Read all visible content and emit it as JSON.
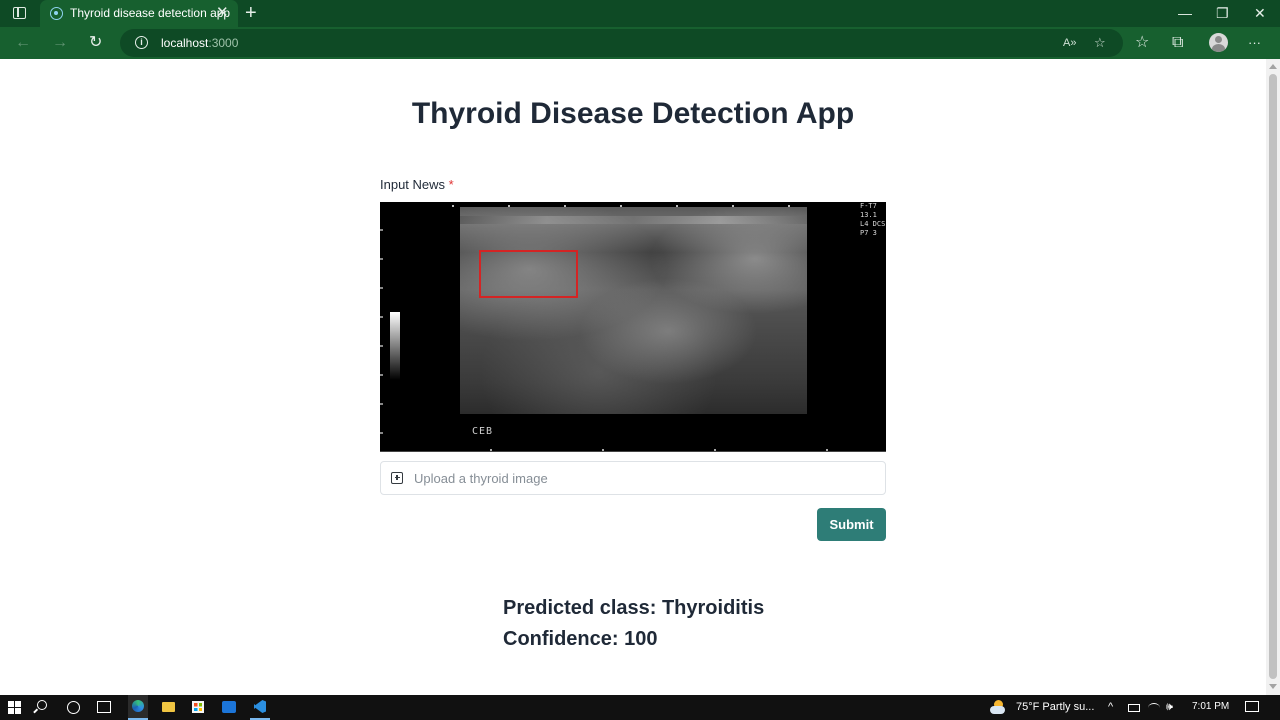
{
  "browser": {
    "tab_title": "Thyroid disease detection app",
    "tab_close": "✕",
    "new_tab": "+",
    "url_host": "localhost",
    "url_port": ":3000",
    "window_buttons": {
      "minimize": "—",
      "restore": "❐",
      "close": "✕"
    },
    "nav": {
      "back": "←",
      "forward": "→",
      "refresh": "↻",
      "info": "i"
    },
    "omnibox_icons": {
      "read_aloud": "A»",
      "add_favorite": "☆"
    },
    "toolbar_icons": {
      "favorites": "☆",
      "collections": "⧉",
      "more": "···"
    }
  },
  "app": {
    "title": "Thyroid Disease Detection App",
    "field_label": "Input News",
    "required_mark": "*",
    "image_label": "CEB",
    "image_side_text": "F-T7 13.1 L4 DCS P7 3",
    "upload_placeholder": "Upload a thyroid image",
    "submit_label": "Submit",
    "predicted_class": "Predicted class: Thyroiditis",
    "confidence": "Confidence: 100"
  },
  "taskbar": {
    "weather_text": "75°F  Partly su...",
    "clock": "7:01 PM",
    "tray_chevron": "^",
    "tray_volume": "🕪"
  },
  "colors": {
    "browser_frame": "#0e4a25",
    "browser_toolbar": "#17602f",
    "submit_button": "#2e7d77",
    "heading_text": "#1f2937",
    "required_mark": "#e03131"
  }
}
